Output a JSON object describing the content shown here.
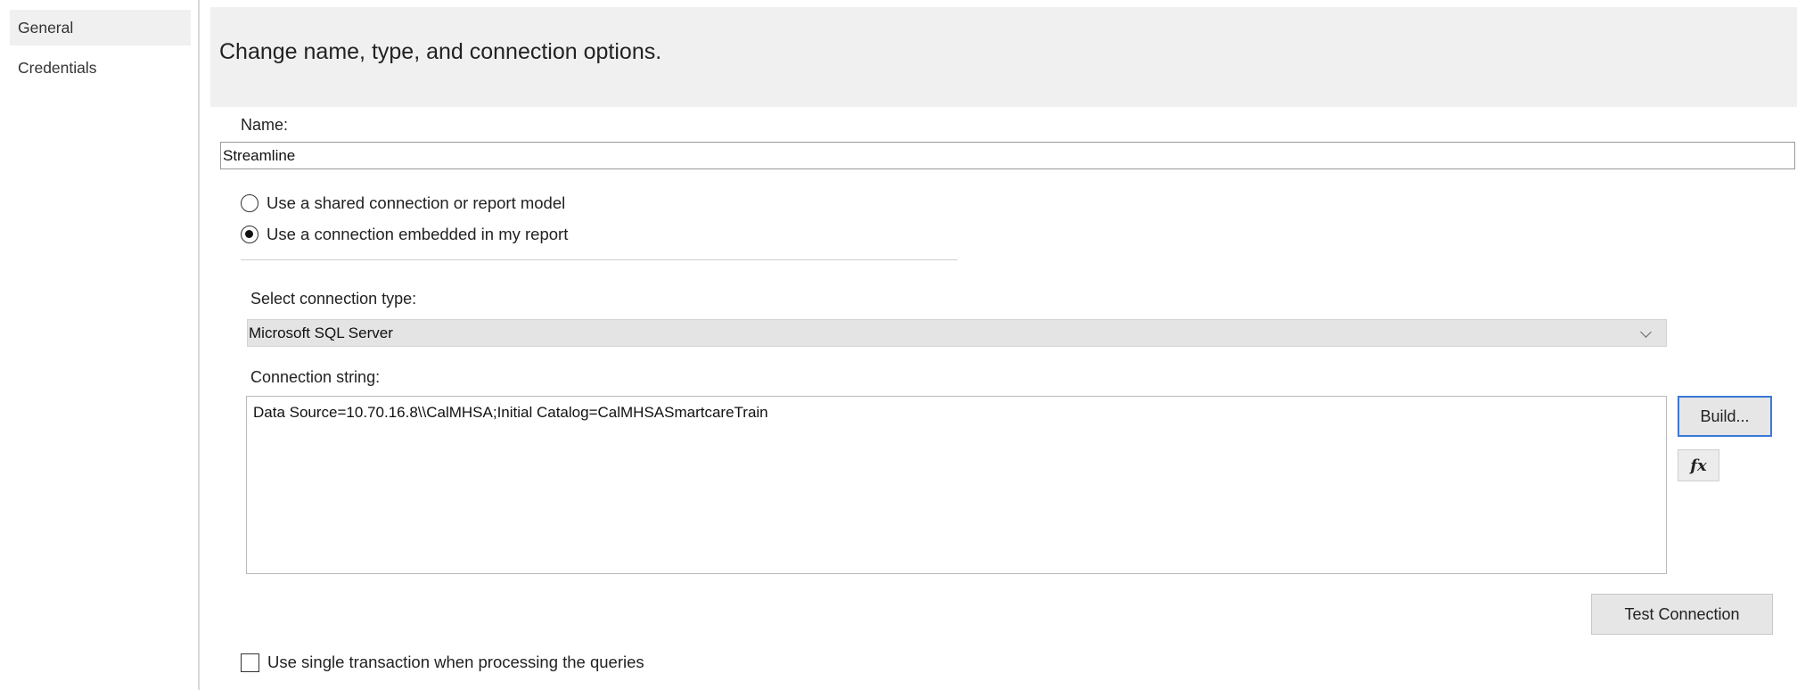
{
  "sidebar": {
    "items": [
      {
        "label": "General",
        "selected": true
      },
      {
        "label": "Credentials",
        "selected": false
      }
    ]
  },
  "header": {
    "title": "Change name, type, and connection options."
  },
  "name": {
    "label": "Name:",
    "value": "Streamline"
  },
  "connection_mode": {
    "shared_label": "Use a shared connection or report model",
    "embedded_label": "Use a connection embedded in my report",
    "selected": "embedded"
  },
  "connection_type": {
    "label": "Select connection type:",
    "value": "Microsoft SQL Server"
  },
  "connection_string": {
    "label": "Connection string:",
    "value": "Data Source=10.70.16.8\\\\CalMHSA;Initial Catalog=CalMHSASmartcareTrain"
  },
  "buttons": {
    "build": "Build...",
    "expression": "fx",
    "test_connection": "Test Connection"
  },
  "single_transaction": {
    "label": "Use single transaction when processing the queries",
    "checked": false
  },
  "icons": {
    "expression": "fx-icon",
    "dropdown": "chevron-down-icon"
  }
}
